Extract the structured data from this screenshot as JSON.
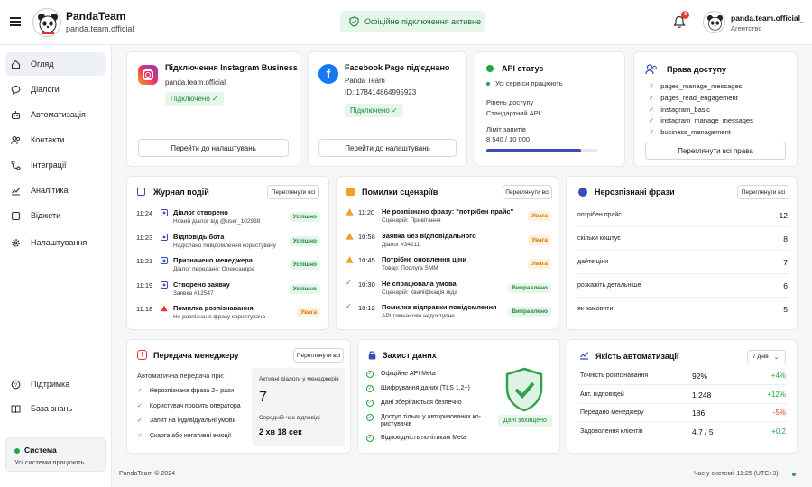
{
  "header": {
    "brand": "PandaTeam",
    "account_url": "panda.team.official",
    "status": "Офіційне підключення активне",
    "notif_count": "3",
    "user_name": "panda.team.official",
    "user_role": "Агентство"
  },
  "sidebar": {
    "items": [
      "Огляд",
      "Діалоги",
      "Автоматизація",
      "Контакти",
      "Інтеграції",
      "Аналітика",
      "Віджети",
      "Налаштування"
    ],
    "support": "Підтримка",
    "kb": "База знань",
    "system_title": "Система",
    "system_status": "Усі системи працюють"
  },
  "instagram": {
    "title": "Підключення Instagram Business",
    "account": "panda.team.official",
    "status": "Підключено",
    "button": "Перейти до налаштувань"
  },
  "facebook": {
    "title": "Facebook Page під'єднано",
    "page": "Panda Team",
    "id": "ID: 178414864995923",
    "status": "Підключено",
    "button": "Перейти до налаштувань"
  },
  "api": {
    "title": "API статус",
    "status": "Усі сервіси працюють",
    "level_label": "Рівень доступу",
    "level": "Стандартний API",
    "limit_label": "Ліміт запитів",
    "limit": "8 540 / 10 000",
    "limit_fraction": 0.854
  },
  "access": {
    "title": "Права доступу",
    "items": [
      "pages_manage_messages",
      "pages_read_engagement",
      "instagram_basic",
      "instagram_manage_messages",
      "business_management"
    ],
    "button": "Переглянути всі права"
  },
  "events": {
    "title": "Журнал подій",
    "button": "Переглянути всі",
    "items": [
      {
        "time": "11:24",
        "title": "Діалог створено",
        "desc": "Новий діалог від @user_102938",
        "badge": "Успішно",
        "kind": "ok"
      },
      {
        "time": "11:23",
        "title": "Відповідь бота",
        "desc": "Надіслано повідомлення користувачу",
        "badge": "Успішно",
        "kind": "ok"
      },
      {
        "time": "11:21",
        "title": "Призначено менеджера",
        "desc": "Діалог передано: Олександра",
        "badge": "Успішно",
        "kind": "ok"
      },
      {
        "time": "11:19",
        "title": "Створено заявку",
        "desc": "Заявка #12547",
        "badge": "Успішно",
        "kind": "ok"
      },
      {
        "time": "11:18",
        "title": "Помилка розпізнавання",
        "desc": "Не розпізнано фразу користувача",
        "badge": "Увага",
        "kind": "warn"
      }
    ]
  },
  "errors": {
    "title": "Помилки сценаріїв",
    "button": "Переглянути всі",
    "items": [
      {
        "time": "11:20",
        "title": "Не розпізнано фразу: \"потрібен прайс\"",
        "desc": "Сценарій: Привітання",
        "badge": "Увага",
        "kind": "warn"
      },
      {
        "time": "10:58",
        "title": "Заявка без відповідального",
        "desc": "Діалог #34211",
        "badge": "Увага",
        "kind": "warn"
      },
      {
        "time": "10:45",
        "title": "Потрібне оновлення ціни",
        "desc": "Товар: Послуга SMM",
        "badge": "Увага",
        "kind": "warn"
      },
      {
        "time": "10:30",
        "title": "Не спрацювала умова",
        "desc": "Сценарій: Кваліфікація ліда",
        "badge": "Виправлено",
        "kind": "ok"
      },
      {
        "time": "10:12",
        "title": "Помилка відправки повідомлення",
        "desc": "API тимчасово недоступне",
        "badge": "Виправлено",
        "kind": "ok"
      }
    ]
  },
  "phrases": {
    "title": "Нерозпізнані фрази",
    "button": "Переглянути всі",
    "items": [
      {
        "text": "потрібен прайс",
        "count": "12"
      },
      {
        "text": "скільки коштує",
        "count": "8"
      },
      {
        "text": "дайте ціни",
        "count": "7"
      },
      {
        "text": "розкажіть детальніше",
        "count": "6"
      },
      {
        "text": "як замовити",
        "count": "5"
      }
    ]
  },
  "handoff": {
    "title": "Передача менеджеру",
    "button": "Переглянути всі",
    "subtitle": "Автоматична передача при:",
    "items": [
      "Нерозпізнана фраза 2+ рази",
      "Користувач просить оператора",
      "Запит на індивідуальні умови",
      "Скарга або негативні емоції"
    ],
    "active_label": "Активні діалоги у менеджерів",
    "active_value": "7",
    "avg_label": "Середній час відповіді",
    "avg_value": "2 хв 18 сек"
  },
  "security": {
    "title": "Захист даних",
    "items": [
      "Офіційне API Meta",
      "Шифрування даних (TLS 1.2+)",
      "Дані зберігаються безпечно",
      "Доступ тільки у авторизованих ко-ристувачів",
      "Відповідність політикам Meta"
    ],
    "shield_label": "Дані захищено"
  },
  "quality": {
    "title": "Якість автоматизації",
    "period": "7 днів",
    "rows": [
      {
        "label": "Точність розпізнавання",
        "value": "92%",
        "delta": "+4%",
        "kind": "pos"
      },
      {
        "label": "Авт. відповідей",
        "value": "1 248",
        "delta": "+12%",
        "kind": "pos"
      },
      {
        "label": "Передано менеджеру",
        "value": "186",
        "delta": "-5%",
        "kind": "neg"
      },
      {
        "label": "Задоволення клієнтів",
        "value": "4.7 / 5",
        "delta": "+0.2",
        "kind": "pos"
      }
    ]
  },
  "footer": {
    "copyright": "PandaTeam © 2024",
    "time": "Час у системі: 11:25 (UTC+3)"
  },
  "colors": {
    "accent": "#3b4cb8",
    "green": "#22a447",
    "orange": "#f0a028",
    "red": "#e53935"
  }
}
